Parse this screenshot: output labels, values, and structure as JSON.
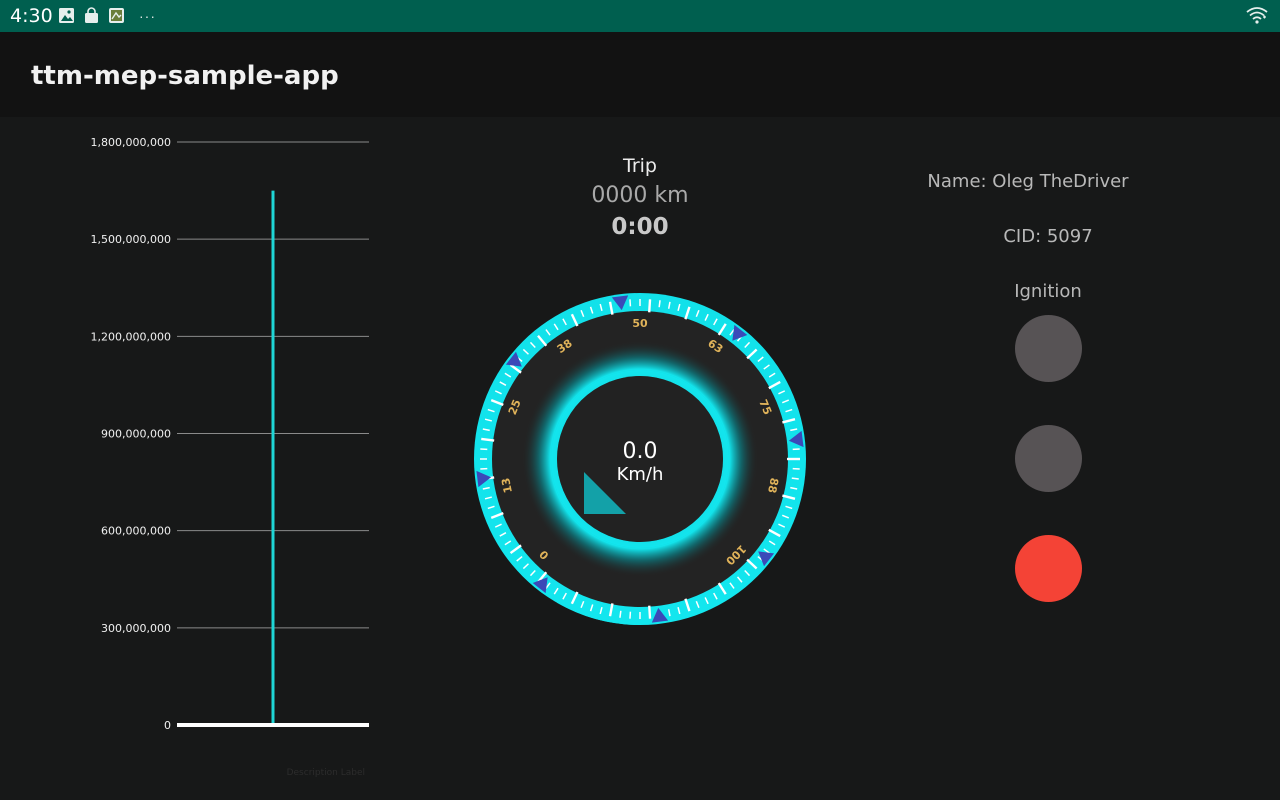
{
  "status_bar": {
    "time": "4:30",
    "icons_left": [
      "gallery-icon",
      "shopping-bag-icon",
      "app-notification-icon"
    ],
    "more": "···",
    "icons_right": [
      "wifi-icon"
    ]
  },
  "app_bar": {
    "title": "ttm-mep-sample-app"
  },
  "chart_data": {
    "type": "bar",
    "y_ticks": [
      "1,800,000,000",
      "1,500,000,000",
      "1,200,000,000",
      "900,000,000",
      "600,000,000",
      "300,000,000",
      "0"
    ],
    "ylim": [
      0,
      1800000000
    ],
    "values": [
      1650000000
    ],
    "description_label": "Description Label",
    "grid": true,
    "color": "#1fd5d5"
  },
  "trip": {
    "label": "Trip",
    "distance": "0000 km",
    "duration": "0:00"
  },
  "speedometer": {
    "value": "0.0",
    "unit": "Km/h",
    "scale_labels": [
      "0",
      "13",
      "25",
      "38",
      "50",
      "63",
      "75",
      "88",
      "100"
    ],
    "accent": "#13e6ee",
    "marker_color": "#3b49b8",
    "label_color": "#e0b35a"
  },
  "driver": {
    "name": "Name: Oleg TheDriver",
    "cid": "CID: 5097"
  },
  "ignition": {
    "label": "Ignition",
    "lamps": [
      {
        "state": "off",
        "color": "#575355"
      },
      {
        "state": "off",
        "color": "#575355"
      },
      {
        "state": "on",
        "color": "#f44336"
      }
    ]
  }
}
